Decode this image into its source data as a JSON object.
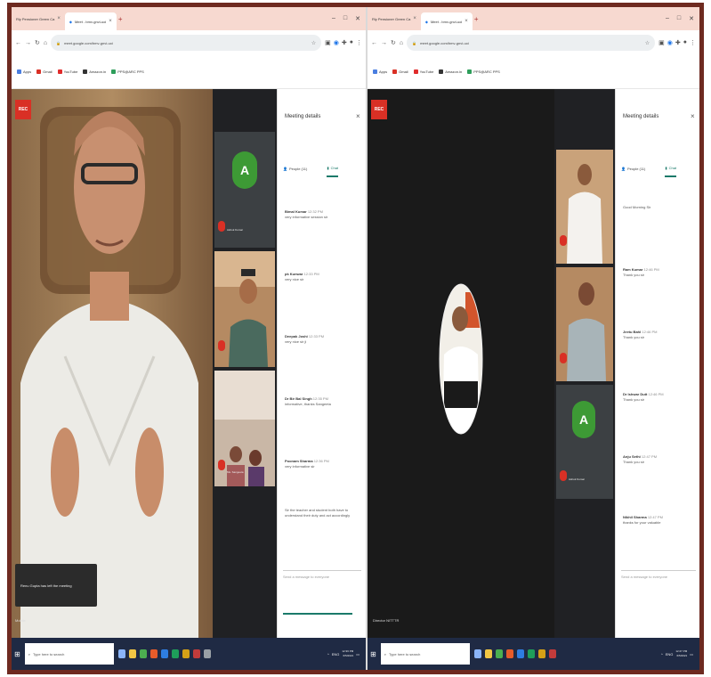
{
  "left": {
    "tabs": [
      {
        "label": "Rly Pensioner Green Ca",
        "active": false
      },
      {
        "label": "Meet - bmv-gnvi-uoi",
        "active": true
      }
    ],
    "url": "meet.google.com/bmv-gnvi-uoi",
    "bookmarks": [
      "Apps",
      "Gmail",
      "YouTube",
      "Amazon.in",
      "PPS@ARC PPS"
    ],
    "panel": {
      "title": "Meeting details",
      "people_tab": "People (11)",
      "chat_tab": "Chat",
      "messages": [
        {
          "name": "Bimal Kumar",
          "time": "12:32 PM",
          "text": "very informative session sir"
        },
        {
          "name": "pk Kunwar",
          "time": "12:33 PM",
          "text": "very nice sir"
        },
        {
          "name": "Deepak Joshi",
          "time": "12:33 PM",
          "text": "very nice sir ji"
        },
        {
          "name": "Dr Bir Bal Singh",
          "time": "12:35 PM",
          "text": "informative, thanks Sangeeta"
        },
        {
          "name": "Poonam Sharma",
          "time": "12:36 PM",
          "text": "very informative sir"
        },
        {
          "name": "",
          "time": "",
          "text": "Sir the teacher and student both have to understand their duty and act accordingly"
        }
      ],
      "send_placeholder": "Send a message to everyone"
    },
    "tiles": [
      {
        "name": "Ashok Kumar",
        "initial": "A"
      },
      {
        "name": "",
        "initial": ""
      },
      {
        "name": "Ms. Sangeeta",
        "initial": ""
      }
    ],
    "toast": "Renu Gupta has left the meeting",
    "self_name": "Mobile"
  },
  "right": {
    "tabs": [
      {
        "label": "Rly Pensioner Green Ca",
        "active": false
      },
      {
        "label": "Meet - bmv-gnvi-uoi",
        "active": true
      }
    ],
    "url": "meet.google.com/bmv-gnvi-uoi",
    "bookmarks": [
      "Apps",
      "Gmail",
      "YouTube",
      "Amazon.in",
      "PPS@ARC PPS"
    ],
    "panel": {
      "title": "Meeting details",
      "people_tab": "People (11)",
      "chat_tab": "Chat",
      "messages": [
        {
          "name": "",
          "time": "",
          "text": "Good Morning Sir"
        },
        {
          "name": "Ram Kumar",
          "time": "12:46 PM",
          "text": "Thank you sir"
        },
        {
          "name": "Jeetu Bahl",
          "time": "12:46 PM",
          "text": "Thank you sir"
        },
        {
          "name": "Dr Ishwar Dutt",
          "time": "12:46 PM",
          "text": "Thank you sir"
        },
        {
          "name": "Anju Sethi",
          "time": "12:47 PM",
          "text": "Thank you sir"
        },
        {
          "name": "Nikhil Sharma",
          "time": "12:47 PM",
          "text": "thanks for your valuable"
        }
      ],
      "send_placeholder": "Send a message to everyone"
    },
    "tiles": [
      {
        "name": "",
        "initial": ""
      },
      {
        "name": "",
        "initial": ""
      },
      {
        "name": "Ashok Kumar",
        "initial": "A"
      }
    ],
    "self_name": "Director NITTTR"
  },
  "taskbar": {
    "search_placeholder": "Type here to search",
    "time_left": "12:36 PM",
    "date_left": "6/5/2021",
    "time_right": "12:47 PM",
    "date_right": "6/5/2021",
    "lang": "ENG"
  },
  "colors": {
    "frame_border": "#6e2a20",
    "tabbar": "#f7d9d0",
    "meet_bg": "#202124",
    "record_red": "#d93025",
    "avatar_green": "#3d9a35",
    "chat_accent": "#1a7a6a",
    "taskbar": "#1f2a44"
  }
}
